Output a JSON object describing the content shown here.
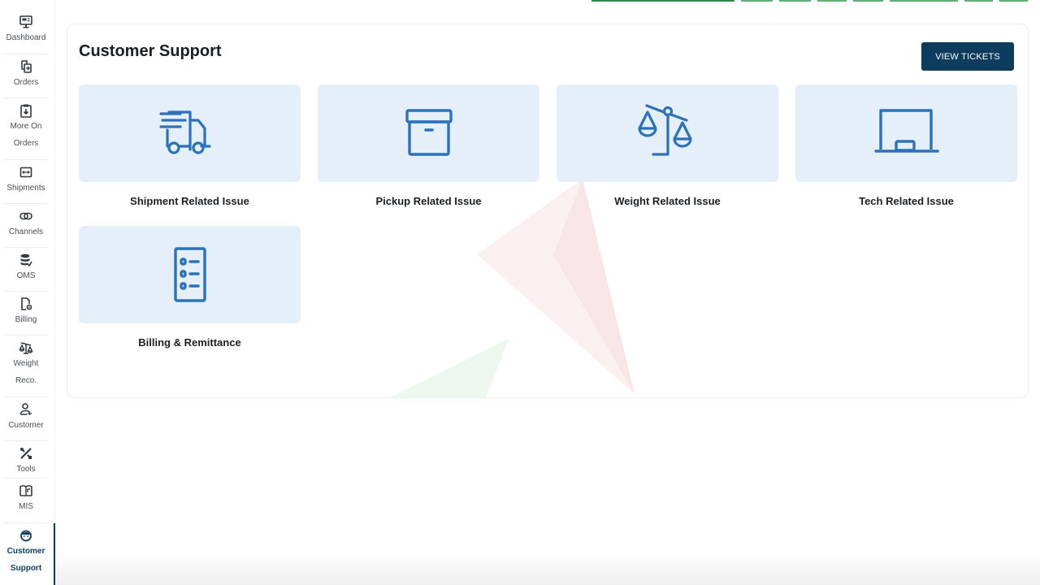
{
  "sidebar": {
    "items": [
      {
        "label": "Dashboard",
        "icon": "monitor-icon"
      },
      {
        "label": "Orders",
        "icon": "orders-icon"
      },
      {
        "label": "More On Orders",
        "icon": "clipboard-icon"
      },
      {
        "label": "Shipments",
        "icon": "shipments-icon"
      },
      {
        "label": "Channels",
        "icon": "link-icon"
      },
      {
        "label": "OMS",
        "icon": "database-icon"
      },
      {
        "label": "Billing",
        "icon": "file-gear-icon"
      },
      {
        "label": "Weight Reco.",
        "icon": "scale-icon"
      },
      {
        "label": "Customer",
        "icon": "user-icon"
      },
      {
        "label": "Tools",
        "icon": "tools-icon"
      },
      {
        "label": "MIS",
        "icon": "book-icon"
      },
      {
        "label": "Customer Support",
        "icon": "support-agent-icon",
        "active": true
      }
    ]
  },
  "page": {
    "title": "Customer Support",
    "view_tickets_label": "VIEW TICKETS"
  },
  "categories": [
    {
      "label": "Shipment Related Issue",
      "icon": "truck-icon"
    },
    {
      "label": "Pickup Related Issue",
      "icon": "box-icon"
    },
    {
      "label": "Weight Related Issue",
      "icon": "scale-icon"
    },
    {
      "label": "Tech Related Issue",
      "icon": "laptop-icon"
    },
    {
      "label": "Billing & Remittance",
      "icon": "list-icon"
    }
  ],
  "colors": {
    "accent": "#0d3c5e",
    "icon_blue": "#2b72b8",
    "tile_bg": "#e4eff9"
  }
}
